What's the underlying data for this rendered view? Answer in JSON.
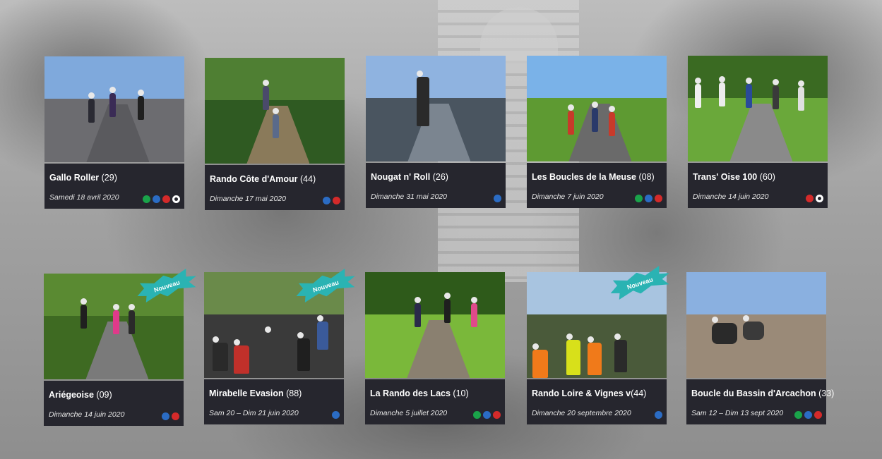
{
  "colors": {
    "card_bg": "#26262e",
    "green": "#1aa34a",
    "blue": "#2b6cc4",
    "red": "#d42a2a",
    "white_ring": "#ffffff",
    "badge": "#2ab3b3"
  },
  "events": [
    {
      "name": "Gallo Roller",
      "count": "(29)",
      "date": "Samedi 18 avril 2020",
      "dots": [
        "green",
        "blue",
        "red",
        "white-ring"
      ],
      "badge": null
    },
    {
      "name": "Rando Côte d'Amour",
      "count": "(44)",
      "date": "Dimanche 17 mai 2020",
      "dots": [
        "blue",
        "red"
      ],
      "badge": null
    },
    {
      "name": "Nougat n' Roll",
      "count": "(26)",
      "date": "Dimanche 31 mai 2020",
      "dots": [
        "blue"
      ],
      "badge": null
    },
    {
      "name": "Les Boucles de la Meuse",
      "count": "(08)",
      "date": "Dimanche 7 juin 2020",
      "dots": [
        "green",
        "blue",
        "red"
      ],
      "badge": null
    },
    {
      "name": "Trans' Oise 100",
      "count": "(60)",
      "date": "Dimanche 14 juin 2020",
      "dots": [
        "red",
        "white-ring"
      ],
      "badge": null
    },
    {
      "name": "Ariégeoise",
      "count": "(09)",
      "date": "Dimanche 14 juin 2020",
      "dots": [
        "blue",
        "red"
      ],
      "badge": "Nouveau"
    },
    {
      "name": "Mirabelle Evasion",
      "count": "(88)",
      "date": "Sam 20 – Dim 21 juin 2020",
      "dots": [
        "blue"
      ],
      "badge": "Nouveau"
    },
    {
      "name": "La Rando des Lacs",
      "count": "(10)",
      "date": "Dimanche 5 juillet 2020",
      "dots": [
        "green",
        "blue",
        "red"
      ],
      "badge": null
    },
    {
      "name": "Rando Loire & Vignes v",
      "count": "(44)",
      "date": "Dimanche 20 septembre 2020",
      "dots": [
        "blue"
      ],
      "badge": "Nouveau"
    },
    {
      "name": "Boucle du Bassin d'Arcachon",
      "count": "(33)",
      "date": "Sam 12 – Dim 13 sept 2020",
      "dots": [
        "green",
        "blue",
        "red"
      ],
      "badge": null
    }
  ]
}
